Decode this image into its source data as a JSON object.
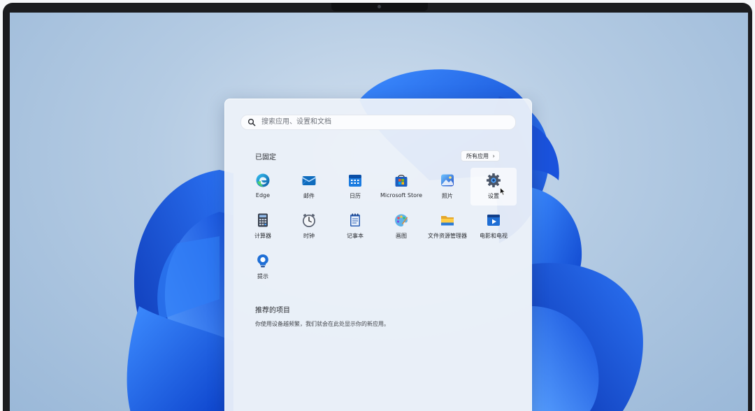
{
  "search": {
    "placeholder": "搜索应用、设置和文档"
  },
  "pinned": {
    "title": "已固定",
    "all_apps_label": "所有应用",
    "apps": [
      {
        "label": "Edge",
        "icon": "edge-icon"
      },
      {
        "label": "邮件",
        "icon": "mail-icon"
      },
      {
        "label": "日历",
        "icon": "calendar-icon"
      },
      {
        "label": "Microsoft Store",
        "icon": "store-icon"
      },
      {
        "label": "照片",
        "icon": "photos-icon"
      },
      {
        "label": "设置",
        "icon": "gear-icon"
      },
      {
        "label": "计算器",
        "icon": "calculator-icon"
      },
      {
        "label": "时钟",
        "icon": "clock-icon"
      },
      {
        "label": "记事本",
        "icon": "notepad-icon"
      },
      {
        "label": "画图",
        "icon": "paint-icon"
      },
      {
        "label": "文件资源管理器",
        "icon": "folder-icon"
      },
      {
        "label": "电影和电视",
        "icon": "movies-tv-icon"
      },
      {
        "label": "提示",
        "icon": "tips-icon"
      }
    ]
  },
  "recommended": {
    "title": "推荐的项目",
    "text": "你使用设备越频繁，我们就会在此处显示你的新应用。"
  },
  "colors": {
    "accent": "#0f6cbd",
    "wallpaper_bloom": "#1e5fe6"
  }
}
